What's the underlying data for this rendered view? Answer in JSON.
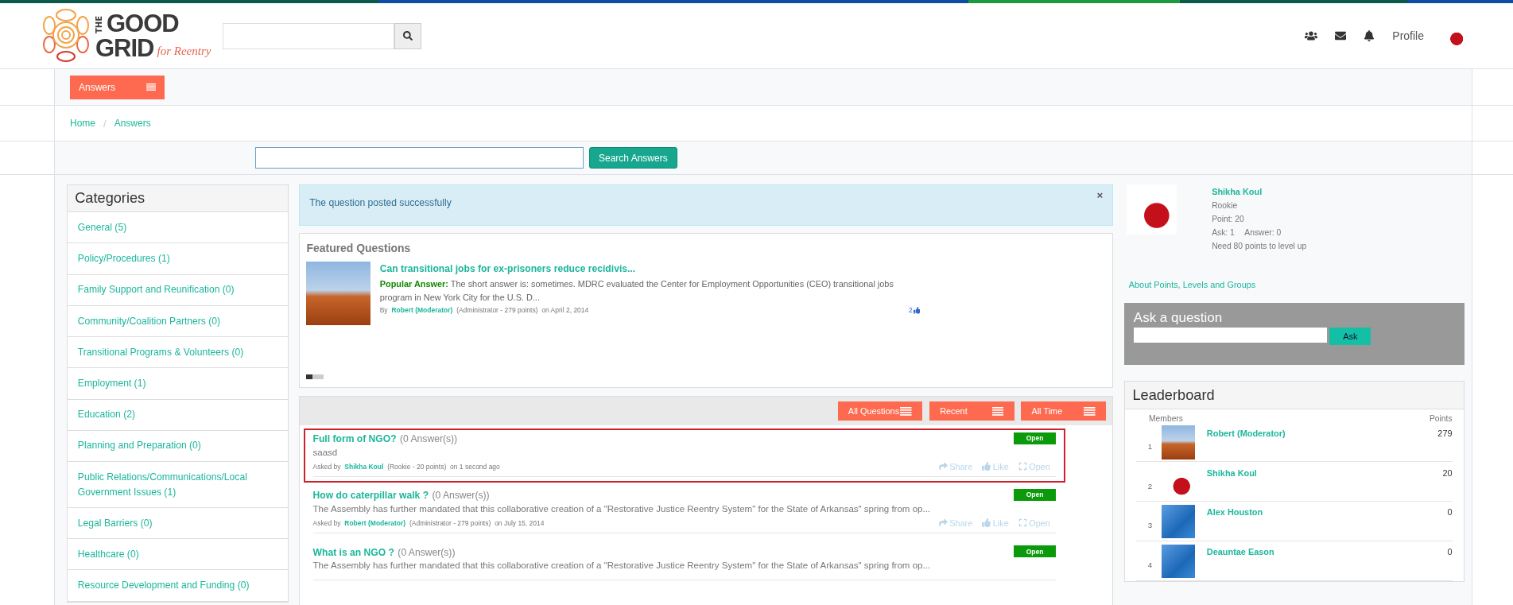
{
  "logo": {
    "the": "THE",
    "good": "GOOD",
    "grid": "GRID",
    "tagline": "for Reentry"
  },
  "header": {
    "profile_label": "Profile"
  },
  "nav": {
    "menu_button": "Answers"
  },
  "breadcrumb": {
    "separator": "/",
    "items": [
      "Home",
      "Answers"
    ]
  },
  "answer_search": {
    "button": "Search Answers"
  },
  "categories": {
    "title": "Categories",
    "items": [
      "General (5)",
      "Policy/Procedures (1)",
      "Family Support and Reunification (0)",
      "Community/Coalition Partners (0)",
      "Transitional Programs & Volunteers (0)",
      "Employment (1)",
      "Education (2)",
      "Planning and Preparation (0)",
      "Public Relations/Communications/Local Government Issues (1)",
      "Legal Barriers (0)",
      "Healthcare (0)",
      "Resource Development and Funding (0)"
    ]
  },
  "alert": {
    "message": "The question posted successfully",
    "close": "×"
  },
  "featured": {
    "title": "Featured Questions",
    "question": "Can transitional jobs for ex-prisoners reduce recidivis...",
    "answer_label": "Popular Answer:",
    "answer_text": "The short answer is: sometimes. MDRC evaluated the Center for Employment Opportunities (CEO) transitional jobs program in New York City for the U.S. D...",
    "by": "By",
    "author": "Robert (Moderator)",
    "role_points": "(Administrator - 279 points)",
    "date": "on April 2, 2014",
    "likes": "2",
    "slides": [
      {
        "selected": true
      },
      {
        "selected": false
      },
      {
        "selected": false
      }
    ]
  },
  "filters": [
    "All Questions",
    "Recent",
    "All Time"
  ],
  "questions": [
    {
      "title": "Full form of NGO?",
      "answers": "(0 Answer(s))",
      "body": "saasd",
      "asked_by": "Asked by",
      "author": "Shikha Koul",
      "role_points": "(Rookie - 20 points)",
      "time": "on 1 second ago",
      "status": "Open",
      "highlighted": true,
      "actions": [
        "Share",
        "Like",
        "Open"
      ]
    },
    {
      "title": "How do caterpillar walk ?",
      "answers": "(0 Answer(s))",
      "body": "The Assembly has further mandated that this collaborative creation of a \"Restorative Justice Reentry System\" for the State of Arkansas\" spring from op...",
      "asked_by": "Asked by",
      "author": "Robert (Moderator)",
      "role_points": "(Administrator - 279 points)",
      "time": "on July 15, 2014",
      "status": "Open",
      "highlighted": false,
      "actions": [
        "Share",
        "Like",
        "Open"
      ]
    },
    {
      "title": "What is an NGO ?",
      "answers": "(0 Answer(s))",
      "body": "The Assembly has further mandated that this collaborative creation of a \"Restorative Justice Reentry System\" for the State of Arkansas\" spring from op...",
      "status": "Open",
      "highlighted": false
    }
  ],
  "profile": {
    "name": "Shikha Koul",
    "level": "Rookie",
    "points": "Point: 20",
    "ask": "Ask: 1",
    "answer": "Answer: 0",
    "next": "Need 80 points to level up",
    "about_link": "About Points, Levels and Groups"
  },
  "ask": {
    "title": "Ask a question",
    "button": "Ask"
  },
  "leaderboard": {
    "title": "Leaderboard",
    "columns": [
      "Members",
      "Points"
    ],
    "rows": [
      {
        "rank": "1",
        "name": "Robert (Moderator)",
        "points": "279",
        "kind": "rock"
      },
      {
        "rank": "2",
        "name": "Shikha Koul",
        "points": "20",
        "kind": "rose"
      },
      {
        "rank": "3",
        "name": "Alex Houston",
        "points": "0",
        "kind": "blue"
      },
      {
        "rank": "4",
        "name": "Deauntae Eason",
        "points": "0",
        "kind": "blue"
      }
    ]
  }
}
